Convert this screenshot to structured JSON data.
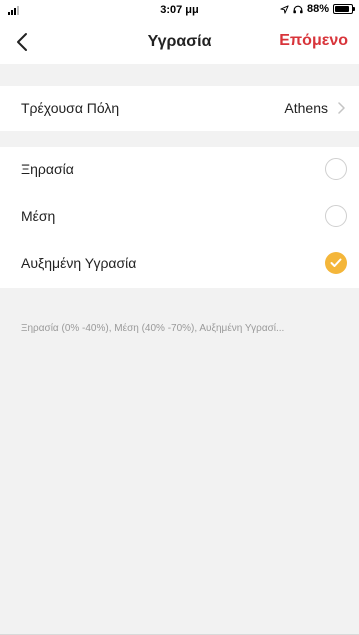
{
  "status_bar": {
    "time": "3:07 μμ",
    "battery_percent": "88%",
    "battery_level": 0.88,
    "icons": [
      "signal-icon",
      "location-arrow-icon",
      "headphones-icon",
      "battery-icon"
    ]
  },
  "nav": {
    "back_icon": "chevron-left-icon",
    "title": "Υγρασία",
    "next_label": "Επόμενο",
    "next_color": "#d8343a"
  },
  "city": {
    "label": "Τρέχουσα Πόλη",
    "value": "Athens",
    "icon": "chevron-right-icon"
  },
  "options": [
    {
      "label": "Ξηρασία",
      "selected": false
    },
    {
      "label": "Μέση",
      "selected": false
    },
    {
      "label": "Αυξημένη Υγρασία",
      "selected": true
    }
  ],
  "selected_color": "#f4b63a",
  "footnote": "Ξηρασία (0% -40%), Μέση (40% -70%), Αυξημένη Υγρασί..."
}
